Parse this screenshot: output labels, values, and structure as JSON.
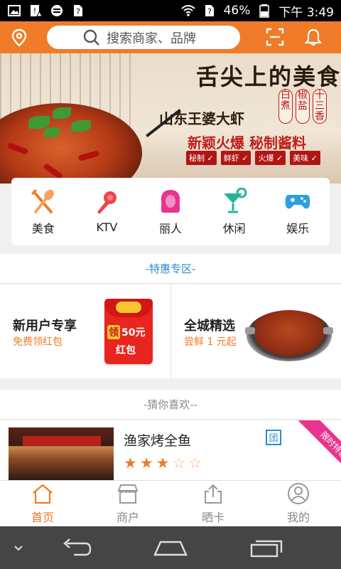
{
  "status_bar": {
    "battery": "46%",
    "time": "下午 3:49",
    "icons": [
      "image-icon",
      "alert-icon",
      "sync-icon",
      "unknown-sim-icon",
      "wifi-icon",
      "unknown-sim-icon",
      "battery-icon"
    ]
  },
  "header": {
    "search_placeholder": "搜索商家、品牌",
    "icons": [
      "location-icon",
      "search-icon",
      "scan-icon",
      "bell-icon"
    ]
  },
  "banner": {
    "title": "舌尖上的美食",
    "seals": [
      "白煮",
      "椒盐",
      "十三香"
    ],
    "subtitle": "山东王婆大虾",
    "slogan": "新颖火爆 秘制酱料",
    "tags": [
      "秘制",
      "鲜虾",
      "火爆",
      "美味"
    ]
  },
  "categories": [
    {
      "label": "美食",
      "icon": "fork-spoon-icon",
      "color": "#f07b28"
    },
    {
      "label": "KTV",
      "icon": "microphone-icon",
      "color": "#e8474c"
    },
    {
      "label": "丽人",
      "icon": "woman-head-icon",
      "color": "#e8338f"
    },
    {
      "label": "休闲",
      "icon": "cocktail-icon",
      "color": "#27b39c"
    },
    {
      "label": "娱乐",
      "icon": "gamepad-icon",
      "color": "#2aa0e0"
    }
  ],
  "special_section": {
    "title": "-特惠专区-",
    "promos": [
      {
        "title": "新用户专享",
        "subtitle": "免费领红包",
        "badge_ling": "领",
        "badge_amount": "50元",
        "badge_label": "红包"
      },
      {
        "title": "全城精选",
        "subtitle": "尝鲜 1 元起"
      }
    ]
  },
  "guess_section": {
    "title": "-猜你喜欢--",
    "items": [
      {
        "name": "渔家烤全鱼",
        "rating": 3,
        "max_rating": 5,
        "group_buy_badge": "团",
        "ribbon": "限时特惠"
      }
    ]
  },
  "tab_bar": {
    "tabs": [
      {
        "label": "首页",
        "icon": "home-icon",
        "active": true
      },
      {
        "label": "商户",
        "icon": "store-icon",
        "active": false
      },
      {
        "label": "晒卡",
        "icon": "share-icon",
        "active": false
      },
      {
        "label": "我的",
        "icon": "user-icon",
        "active": false
      }
    ]
  },
  "accent_color": "#f07b28",
  "nav_bar": {
    "icons": [
      "chevron-down-icon",
      "back-icon",
      "home-nav-icon",
      "recents-icon"
    ]
  }
}
